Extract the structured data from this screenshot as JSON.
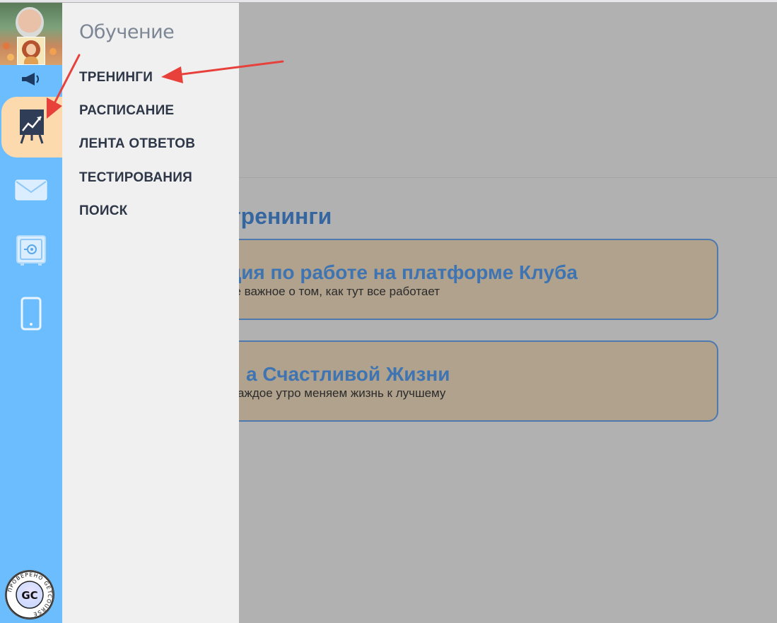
{
  "menu": {
    "title": "Обучение",
    "items": [
      {
        "label": "ТРЕНИНГИ"
      },
      {
        "label": "РАСПИСАНИЕ"
      },
      {
        "label": "ЛЕНТА ОТВЕТОВ"
      },
      {
        "label": "ТЕСТИРОВАНИЯ"
      },
      {
        "label": "ПОИСК"
      }
    ]
  },
  "sidebar": {
    "icons": [
      "megaphone-icon",
      "training-chart-icon",
      "mail-icon",
      "safe-icon",
      "mobile-phone-icon"
    ],
    "active": "training-chart-icon",
    "badge": {
      "initials": "GC",
      "ring_text": "ПРОВЕРЕНО GETCOURSE"
    }
  },
  "main": {
    "section_title": "тренинги",
    "cards": [
      {
        "title": "ция по работе на платформе Клуба",
        "subtitle": "ое важное о том, как тут все работает"
      },
      {
        "title": "а Счастливой Жизни",
        "subtitle": "аждое утро меняем жизнь к лучшему"
      }
    ]
  },
  "colors": {
    "rail": "#6cbdfd",
    "active_tab": "#fcdaae",
    "menu_bg": "#f0f0f0",
    "overlay": "#b1b1b1",
    "card_bg": "#b0a28c",
    "card_border": "#4d79ae",
    "arrow": "#e8403a"
  }
}
